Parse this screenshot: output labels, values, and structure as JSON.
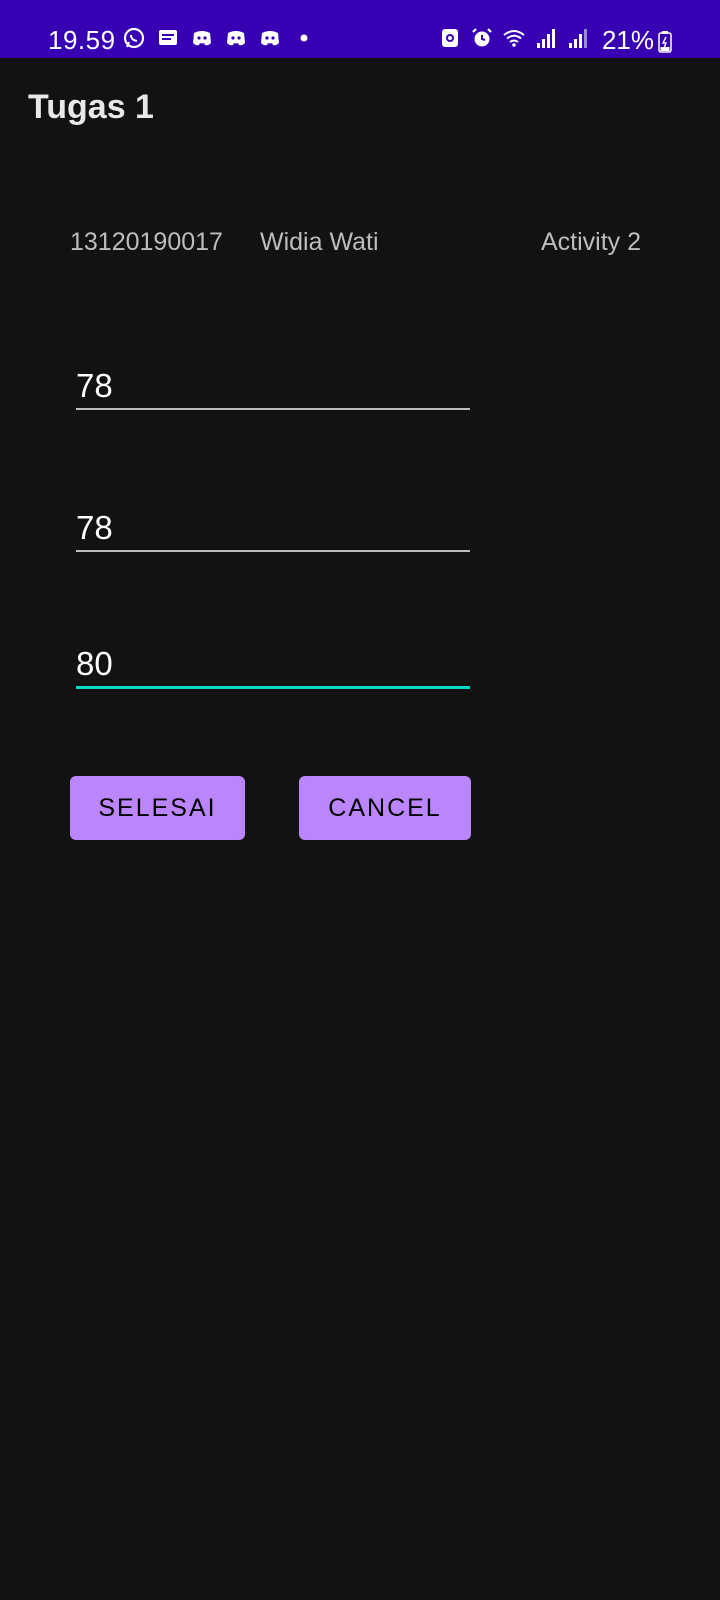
{
  "status_bar": {
    "time": "19.59",
    "battery_percent": "21%",
    "left_icons": [
      "whatsapp-icon",
      "message-icon",
      "discord-icon",
      "discord-icon",
      "discord-icon",
      "dot-icon"
    ],
    "right_icons": [
      "nfc-icon",
      "alarm-icon",
      "wifi-icon",
      "signal-icon",
      "signal-icon"
    ],
    "background_color": "#3700b3"
  },
  "toolbar": {
    "title": "Tugas 1"
  },
  "info": {
    "nim": "13120190017",
    "name": "Widia Wati",
    "activity": "Activity 2"
  },
  "inputs": [
    {
      "value": "78",
      "focused": false
    },
    {
      "value": "78",
      "focused": false
    },
    {
      "value": "80",
      "focused": true
    }
  ],
  "buttons": {
    "selesai_label": "SELESAI",
    "cancel_label": "CANCEL"
  },
  "colors": {
    "background": "#121212",
    "button": "#bb86fc",
    "focus_accent": "#03dac5"
  }
}
